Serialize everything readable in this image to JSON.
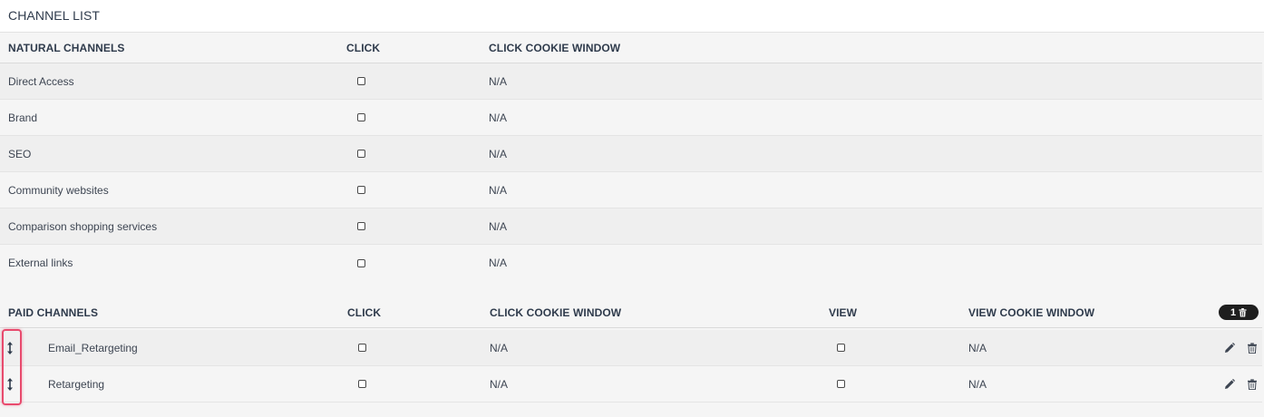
{
  "page_title": "CHANNEL LIST",
  "natural": {
    "headers": {
      "name": "NATURAL CHANNELS",
      "click": "CLICK",
      "click_cookie": "CLICK COOKIE WINDOW"
    },
    "rows": [
      {
        "name": "Direct Access",
        "click_checked": false,
        "click_cookie": "N/A"
      },
      {
        "name": "Brand",
        "click_checked": false,
        "click_cookie": "N/A"
      },
      {
        "name": "SEO",
        "click_checked": false,
        "click_cookie": "N/A"
      },
      {
        "name": "Community websites",
        "click_checked": false,
        "click_cookie": "N/A"
      },
      {
        "name": "Comparison shopping services",
        "click_checked": false,
        "click_cookie": "N/A"
      },
      {
        "name": "External links",
        "click_checked": false,
        "click_cookie": "N/A"
      }
    ]
  },
  "paid": {
    "headers": {
      "name": "PAID CHANNELS",
      "click": "CLICK",
      "click_cookie": "CLICK COOKIE WINDOW",
      "view": "VIEW",
      "view_cookie": "VIEW COOKIE WINDOW"
    },
    "deleted_badge": {
      "count": "1",
      "icon": "trash-icon"
    },
    "rows": [
      {
        "name": "Email_Retargeting",
        "click_checked": false,
        "click_cookie": "N/A",
        "view_checked": false,
        "view_cookie": "N/A"
      },
      {
        "name": "Retargeting",
        "click_checked": false,
        "click_cookie": "N/A",
        "view_checked": false,
        "view_cookie": "N/A"
      }
    ]
  },
  "icons": {
    "drag": "drag-vertical-icon",
    "edit": "pencil-icon",
    "delete": "trash-icon"
  },
  "colors": {
    "highlight": "#e84a6d",
    "badge_bg": "#1e1e1e",
    "row_alt": "#efefef",
    "row_base": "#f5f5f5"
  }
}
